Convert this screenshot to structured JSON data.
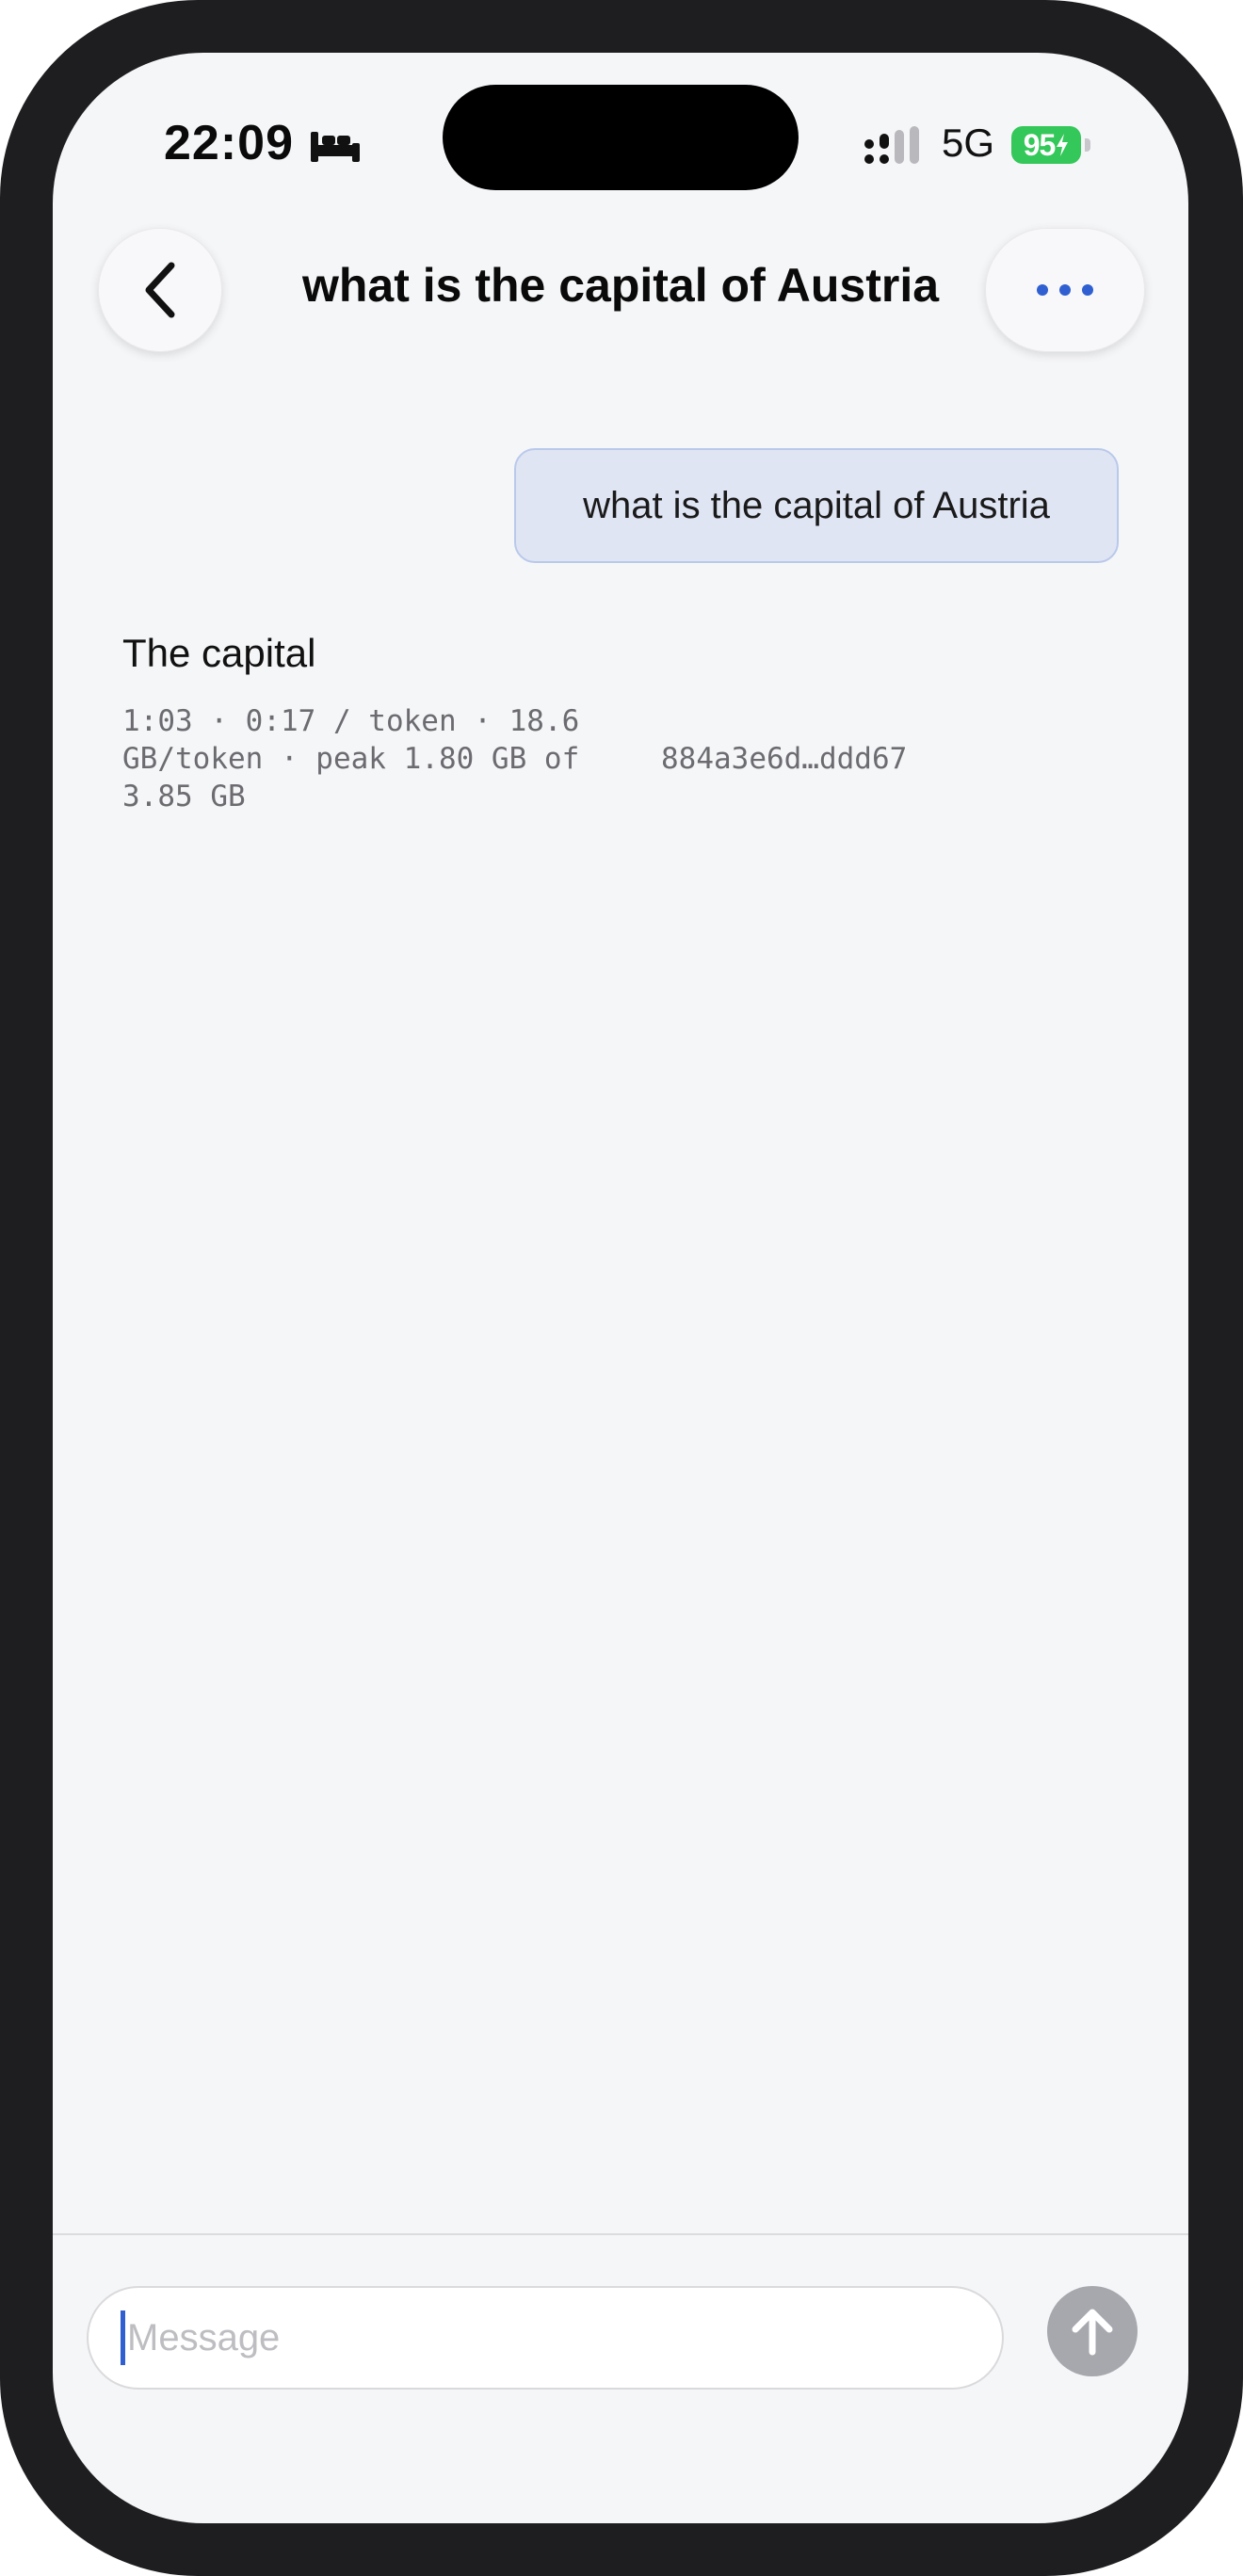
{
  "status_bar": {
    "time": "22:09",
    "network": "5G",
    "battery": "95",
    "icons": [
      "bed-icon",
      "signal-icon",
      "battery-icon"
    ]
  },
  "header": {
    "title": "what is the capital of Austria",
    "back_icon": "chevron-left-icon",
    "more_icon": "ellipsis-icon"
  },
  "messages": [
    {
      "role": "user",
      "text": "what is the capital of Austria"
    },
    {
      "role": "assistant",
      "text": "The capital",
      "meta_stats": "1:03 · 0:17 / token · 18.6 GB/token · peak 1.80 GB of 3.85 GB",
      "meta_hash": "884a3e6d…ddd67"
    }
  ],
  "composer": {
    "placeholder": "Message",
    "send_icon": "arrow-up-icon"
  },
  "colors": {
    "accent": "#2f5fd0",
    "user_bubble": "#e0e5f4",
    "battery": "#34c759",
    "send_disabled": "#a7a8ad"
  }
}
